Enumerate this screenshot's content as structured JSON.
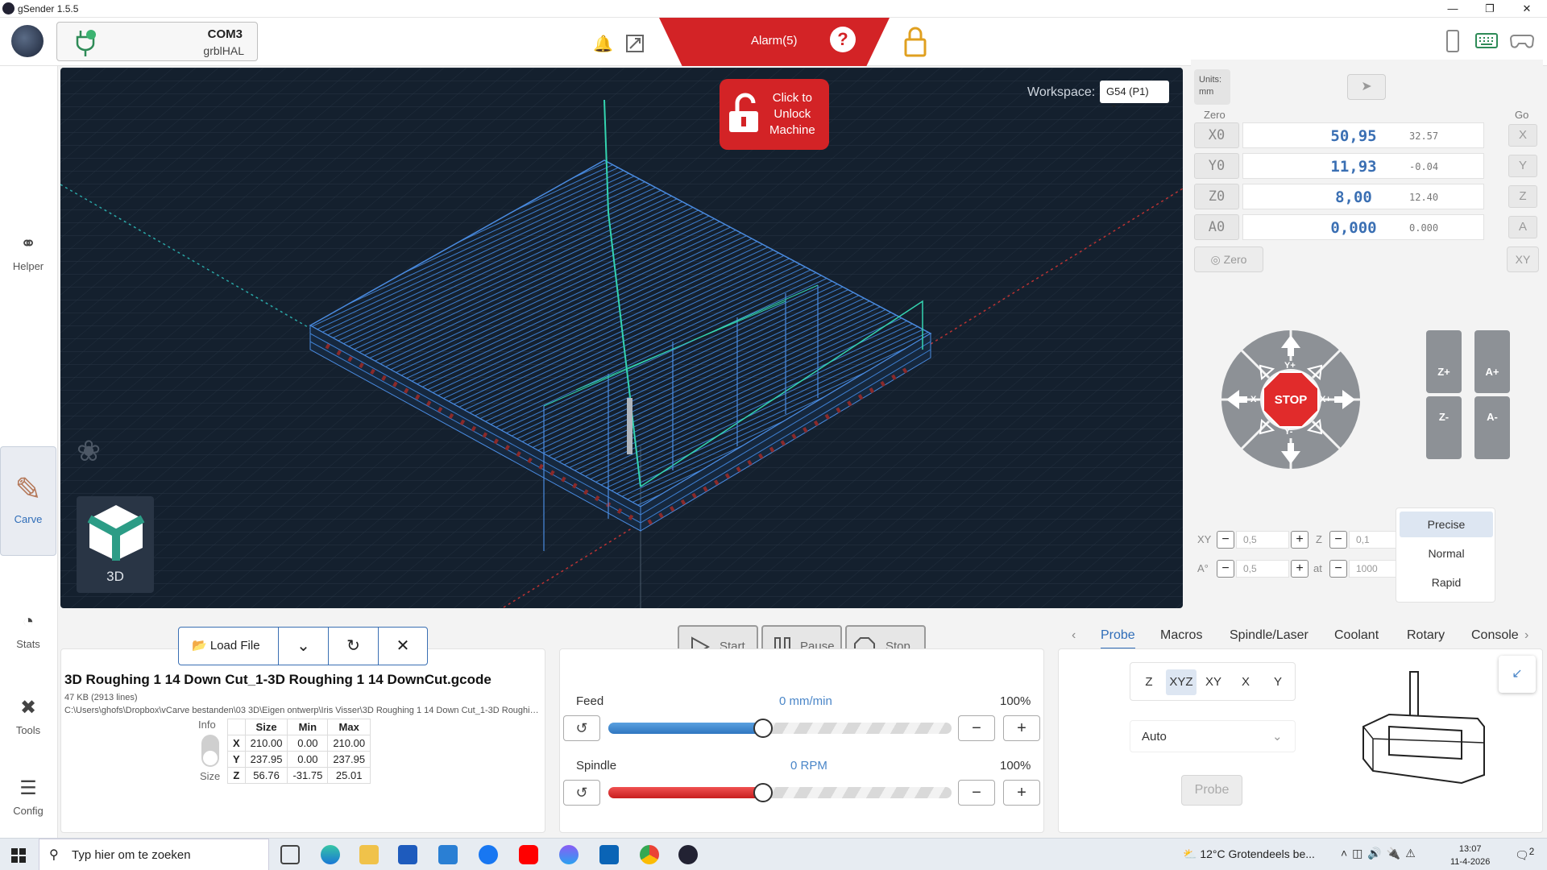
{
  "window": {
    "title": "gSender 1.5.5"
  },
  "header": {
    "port": "COM3",
    "firmware": "grblHAL",
    "alarm_label": "Alarm(5)",
    "help_label": "?"
  },
  "sidebar": {
    "items": [
      {
        "label": "Helper"
      },
      {
        "label": "Carve"
      },
      {
        "label": "Stats"
      },
      {
        "label": "Tools"
      },
      {
        "label": "Config"
      }
    ]
  },
  "viewport": {
    "unlock_label_1": "Click to",
    "unlock_label_2": "Unlock",
    "unlock_label_3": "Machine",
    "workspace_label": "Workspace:",
    "workspace_value": "G54 (P1)",
    "view_label": "3D"
  },
  "dro": {
    "units_label": "Units:",
    "units_value": "mm",
    "zero_header": "Zero",
    "go_header": "Go",
    "axes": [
      {
        "zero": "X0",
        "work": "50,95",
        "machine": "32.57",
        "go": "X"
      },
      {
        "zero": "Y0",
        "work": "11,93",
        "machine": "-0.04",
        "go": "Y"
      },
      {
        "zero": "Z0",
        "work": "8,00",
        "machine": "12.40",
        "go": "Z"
      },
      {
        "zero": "A0",
        "work": "0,000",
        "machine": "0.000",
        "go": "A"
      }
    ],
    "zero_all": "Zero",
    "go_xy": "XY"
  },
  "jog": {
    "stop": "STOP",
    "xp": "X+",
    "xm": "X-",
    "yp": "Y+",
    "ym": "Y-",
    "zp": "Z+",
    "zm": "Z-",
    "ap": "A+",
    "am": "A-",
    "xy_label": "XY",
    "xy_value": "0,5",
    "z_label": "Z",
    "z_value": "0,1",
    "a_label": "A°",
    "a_value": "0,5",
    "at_label": "at",
    "feed_value": "1000",
    "speeds": [
      "Precise",
      "Normal",
      "Rapid"
    ]
  },
  "file": {
    "load_label": "Load File",
    "name": "3D Roughing 1 14 Down Cut_1-3D Roughing 1 14 DownCut.gcode",
    "meta": "47 KB (2913 lines)",
    "path": "C:\\Users\\ghofs\\Dropbox\\vCarve bestanden\\03 3D\\Eigen ontwerp\\Iris Visser\\3D Roughing 1 14 Down Cut_1-3D Roughing 1 14 DownCut.gcode",
    "toggle_info": "Info",
    "toggle_size": "Size",
    "table": {
      "headers": [
        "",
        "Size",
        "Min",
        "Max"
      ],
      "rows": [
        [
          "X",
          "210.00",
          "0.00",
          "210.00"
        ],
        [
          "Y",
          "237.95",
          "0.00",
          "237.95"
        ],
        [
          "Z",
          "56.76",
          "-31.75",
          "25.01"
        ]
      ]
    }
  },
  "run": {
    "start": "Start",
    "pause": "Pause",
    "stop": "Stop"
  },
  "override": {
    "feed_label": "Feed",
    "feed_value": "0 mm/min",
    "feed_pct": "100%",
    "feed_fill": 0.45,
    "spindle_label": "Spindle",
    "spindle_value": "0 RPM",
    "spindle_pct": "100%",
    "spindle_fill": 0.45
  },
  "tools": {
    "tabs": [
      "Probe",
      "Macros",
      "Spindle/Laser",
      "Coolant",
      "Rotary",
      "Console"
    ],
    "probe_axes": [
      "Z",
      "XYZ",
      "XY",
      "X",
      "Y"
    ],
    "probe_type": "Auto",
    "probe_button": "Probe"
  },
  "taskbar": {
    "search_placeholder": "Typ hier om te zoeken",
    "weather": "12°C  Grotendeels be...",
    "time": "13:07",
    "date": "11-4-2026",
    "notif_count": "2"
  }
}
